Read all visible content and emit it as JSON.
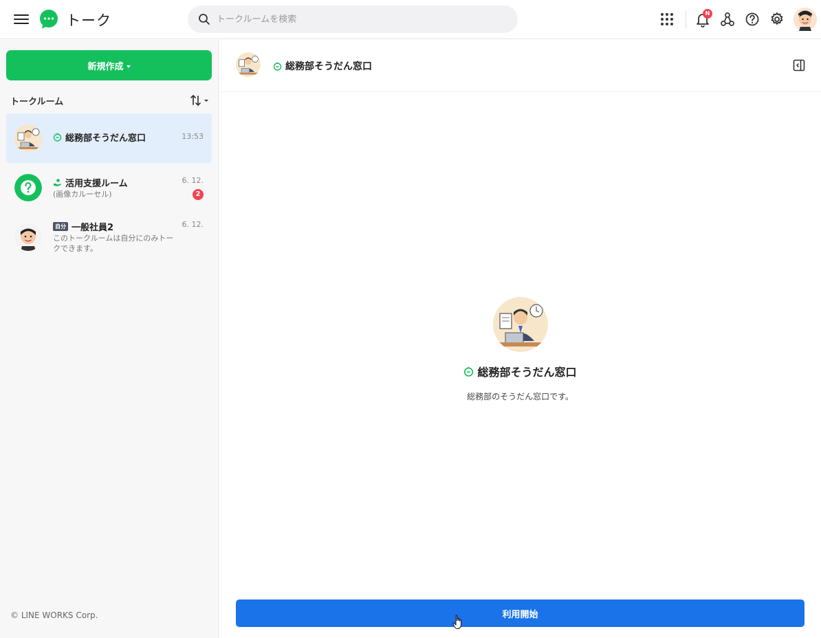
{
  "header": {
    "app_title": "トーク",
    "search_placeholder": "トークルームを検索",
    "notification_badge": "N",
    "icons": [
      "menu-icon",
      "apps-grid-icon",
      "bell-icon",
      "org-chart-icon",
      "help-icon",
      "gear-icon"
    ]
  },
  "sidebar": {
    "new_button_label": "新規作成",
    "section_title": "トークルーム",
    "rooms": [
      {
        "name": "総務部そうだん窓口",
        "time": "13:53",
        "subtitle": "",
        "unread": "",
        "active": true
      },
      {
        "name": "活用支援ルーム",
        "time": "6. 12.",
        "subtitle": "(画像カルーセル)",
        "unread": "2",
        "active": false
      },
      {
        "name": "一般社員2",
        "tag": "自分",
        "time": "6. 12.",
        "subtitle": "このトークルームは自分にのみトークできます。",
        "unread": "",
        "active": false
      }
    ],
    "copyright": "© LINE WORKS Corp."
  },
  "main": {
    "room_title": "総務部そうだん窓口",
    "profile_name": "総務部そうだん窓口",
    "profile_description": "総務部のそうだん窓口です。",
    "start_button_label": "利用開始"
  },
  "colors": {
    "brand_green": "#14c05c",
    "primary_blue": "#1a73e8",
    "badge_red": "#f04452",
    "active_row": "#e3eefc"
  }
}
